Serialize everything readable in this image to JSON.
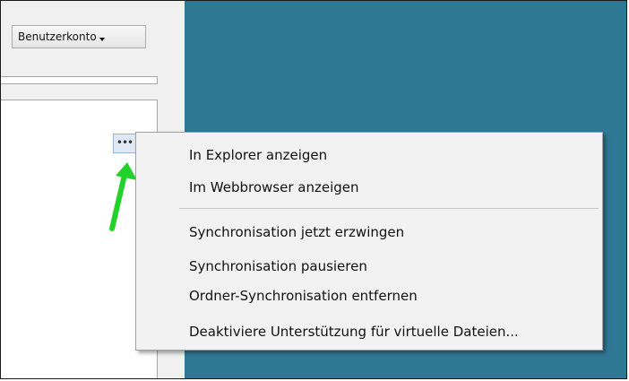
{
  "account_button": {
    "label": "Benutzerkonto",
    "icon": "chevron-down-icon"
  },
  "more_button": {
    "label": "•••",
    "icon": "more-dots-icon"
  },
  "annotation_arrow": {
    "icon": "arrow-up-icon",
    "color": "#22d12a"
  },
  "colors": {
    "desktop_background": "#2f7894",
    "panel_background": "#f0f0f0",
    "menu_background": "#f2f2f2"
  },
  "context_menu": {
    "items": [
      {
        "label": "In Explorer anzeigen"
      },
      {
        "label": "Im Webbrowser anzeigen"
      },
      {
        "label": "Synchronisation jetzt erzwingen"
      },
      {
        "label": "Synchronisation pausieren"
      },
      {
        "label": "Ordner-Synchronisation entfernen"
      },
      {
        "label": "Deaktiviere Unterstützung für virtuelle Dateien..."
      }
    ]
  }
}
